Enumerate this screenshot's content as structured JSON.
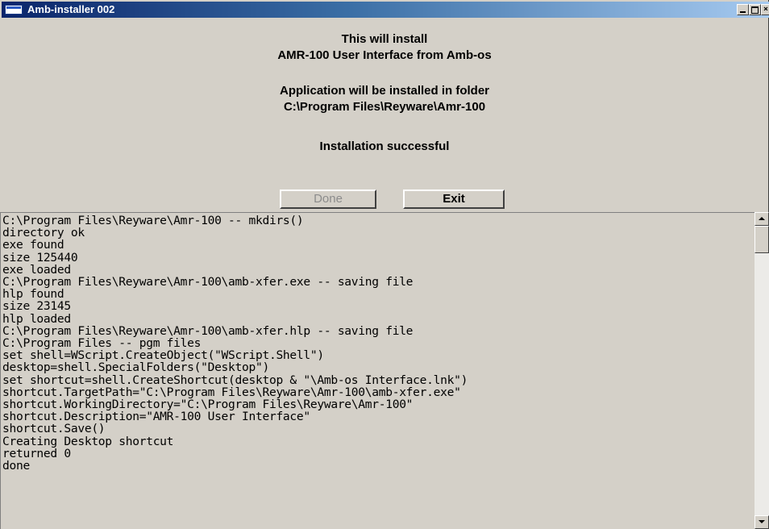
{
  "window": {
    "title": "Amb-installer 002"
  },
  "message": {
    "line1": "This will install",
    "line2": "AMR-100 User Interface from Amb-os",
    "line3": "Application will be installed in folder",
    "line4": "C:\\Program Files\\Reyware\\Amr-100",
    "line5": "Installation successful"
  },
  "buttons": {
    "done": "Done",
    "exit": "Exit"
  },
  "log": {
    "lines": [
      "C:\\Program Files\\Reyware\\Amr-100 -- mkdirs()",
      "directory ok",
      "exe found",
      "size 125440",
      "exe loaded",
      "C:\\Program Files\\Reyware\\Amr-100\\amb-xfer.exe -- saving file",
      "hlp found",
      "size 23145",
      "hlp loaded",
      "C:\\Program Files\\Reyware\\Amr-100\\amb-xfer.hlp -- saving file",
      "C:\\Program Files -- pgm files",
      "set shell=WScript.CreateObject(\"WScript.Shell\")",
      "desktop=shell.SpecialFolders(\"Desktop\")",
      "set shortcut=shell.CreateShortcut(desktop & \"\\Amb-os Interface.lnk\")",
      "shortcut.TargetPath=\"C:\\Program Files\\Reyware\\Amr-100\\amb-xfer.exe\"",
      "shortcut.WorkingDirectory=\"C:\\Program Files\\Reyware\\Amr-100\"",
      "shortcut.Description=\"AMR-100 User Interface\"",
      "shortcut.Save()",
      "Creating Desktop shortcut",
      "returned 0",
      "done"
    ]
  },
  "icons": {
    "app": "window-icon",
    "minimize": "minimize-icon",
    "maximize": "maximize-icon",
    "close": "close-icon",
    "scroll_up": "arrow-up-icon",
    "scroll_down": "arrow-down-icon"
  },
  "colors": {
    "titlebar_start": "#0a246a",
    "titlebar_end": "#a6caf0",
    "face": "#d4d0c8",
    "disabled_text": "#8c8c8c"
  }
}
